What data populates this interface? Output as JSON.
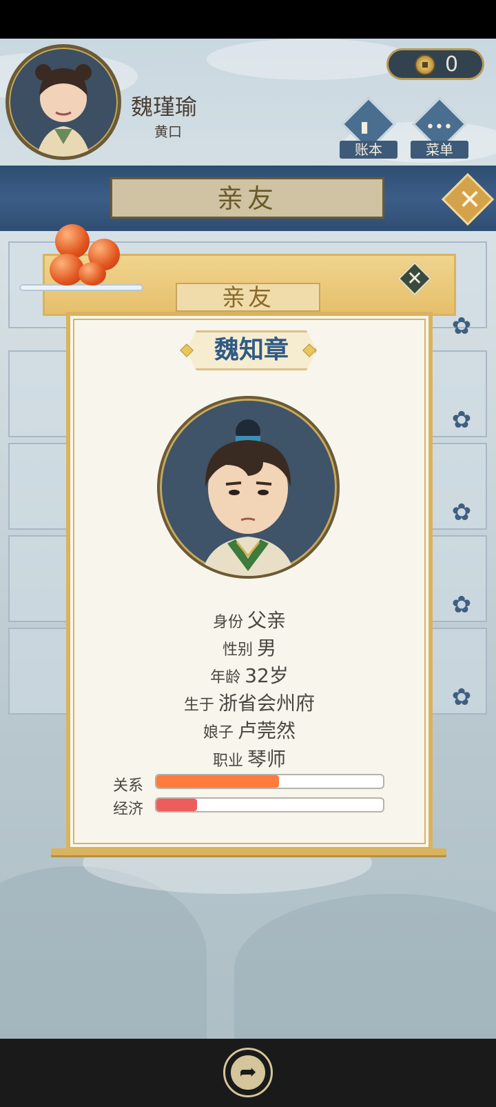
{
  "player": {
    "name": "魏瑾瑜",
    "title": "黄口",
    "coins": "0"
  },
  "header_buttons": {
    "ledger_label": "账本",
    "menu_label": "菜单"
  },
  "tab": {
    "title": "亲友"
  },
  "dialog": {
    "header": "亲友",
    "name": "魏知章",
    "details": [
      {
        "key": "身份",
        "value": "父亲"
      },
      {
        "key": "性别",
        "value": "男"
      },
      {
        "key": "年龄",
        "value": "32岁"
      },
      {
        "key": "生于",
        "value": "浙省会州府"
      },
      {
        "key": "娘子",
        "value": "卢莞然"
      },
      {
        "key": "职业",
        "value": "琴师"
      }
    ],
    "bars": [
      {
        "label": "关系",
        "level": 0.54,
        "color": "#ff7a3d"
      },
      {
        "label": "经济",
        "level": 0.18,
        "color": "#ee5d5d"
      }
    ]
  },
  "colors": {
    "accent_gold": "#d9b35e",
    "name_blue": "#2f5a86",
    "band_blue": "#2f4d72"
  },
  "icons": {
    "coin": "coin-icon",
    "ledger": "ledger-icon",
    "menu": "menu-dots-icon",
    "close": "close-icon",
    "share": "share-icon",
    "flower": "plum-flower-icon"
  }
}
